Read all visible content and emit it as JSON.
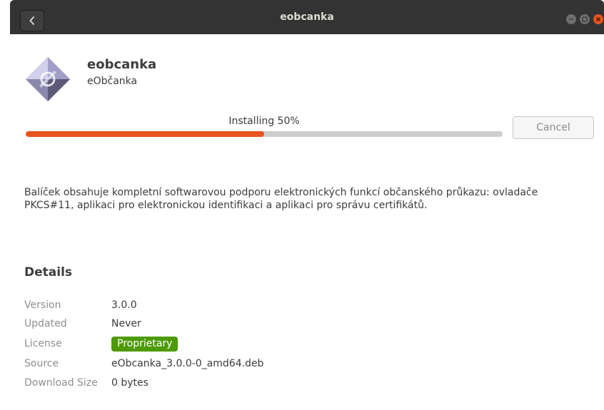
{
  "window": {
    "title": "eobcanka"
  },
  "app": {
    "name": "eobcanka",
    "summary": "eObčanka"
  },
  "install": {
    "status_label": "Installing 50%",
    "progress_percent": 50,
    "cancel_label": "Cancel"
  },
  "description": "Balíček obsahuje kompletní softwarovou podporu elektronických funkcí občanského průkazu: ovladače PKCS#11, aplikaci pro elektronickou identifikaci a aplikaci pro správu certifikátů.",
  "details": {
    "heading": "Details",
    "version": {
      "label": "Version",
      "value": "3.0.0"
    },
    "updated": {
      "label": "Updated",
      "value": "Never"
    },
    "license": {
      "label": "License",
      "value": "Proprietary"
    },
    "source": {
      "label": "Source",
      "value": "eObcanka_3.0.0-0_amd64.deb"
    },
    "download_size": {
      "label": "Download Size",
      "value": "0 bytes"
    }
  },
  "colors": {
    "accent": "#e95420",
    "license_badge": "#4e9a06",
    "titlebar": "#333333"
  },
  "icons": {
    "back": "chevron-left-icon",
    "app": "eobcanka-app-icon",
    "minimize": "minimize-icon",
    "maximize": "maximize-icon",
    "close": "close-icon"
  }
}
